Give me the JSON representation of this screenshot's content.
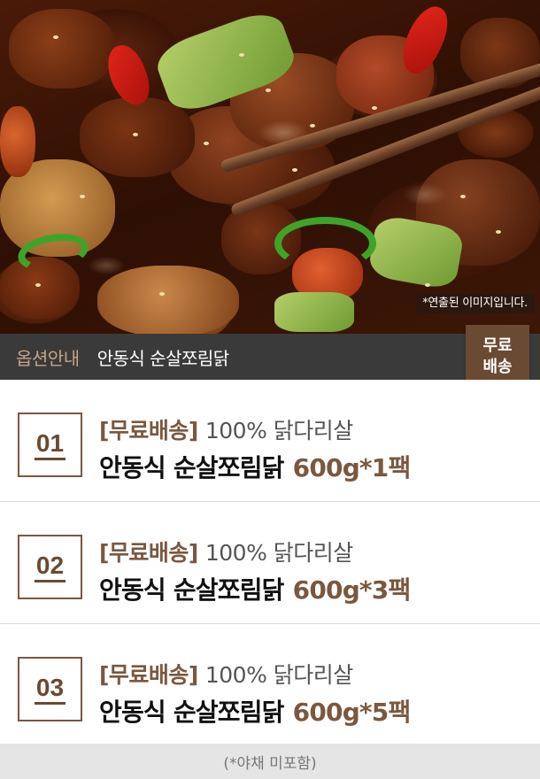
{
  "hero": {
    "image_name": "braised-chicken-photo",
    "note": "*연출된 이미지입니다."
  },
  "option_bar": {
    "label": "옵션안내",
    "product": "안동식 순살쪼림닭"
  },
  "badge": {
    "line1": "무료",
    "line2": "배송"
  },
  "options": [
    {
      "number": "01",
      "tag": "[무료배송]",
      "desc": "100% 닭다리살",
      "name": "안동식 순살쪼림닭",
      "qty": "600g*1팩"
    },
    {
      "number": "02",
      "tag": "[무료배송]",
      "desc": "100% 닭다리살",
      "name": "안동식 순살쪼림닭",
      "qty": "600g*3팩"
    },
    {
      "number": "03",
      "tag": "[무료배송]",
      "desc": "100% 닭다리살",
      "name": "안동식 순살쪼림닭",
      "qty": "600g*5팩"
    }
  ],
  "footer": {
    "note": "(*야채 미포함)"
  },
  "colors": {
    "brown_accent": "#6b4a33",
    "header_bar": "#3b3a3a",
    "footer_bg": "#e5e5e5"
  }
}
